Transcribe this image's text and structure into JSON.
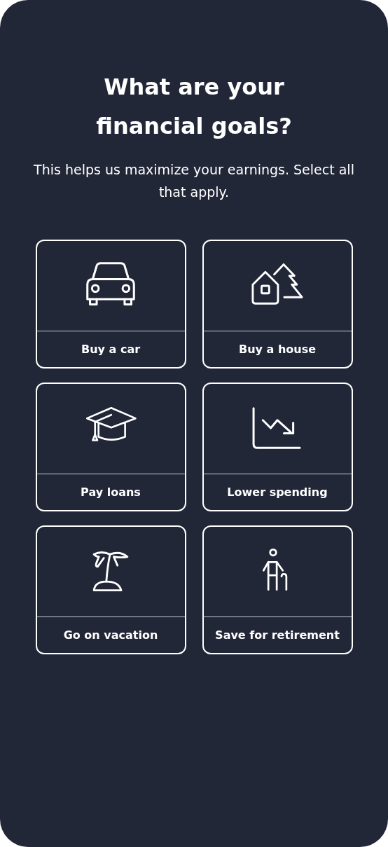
{
  "title": "What are your financial goals?",
  "subtitle": "This helps us maximize your earnings. Select all that apply.",
  "goals": [
    {
      "kind": "car",
      "label": "Buy a car",
      "selected": false
    },
    {
      "kind": "house",
      "label": "Buy a house",
      "selected": false
    },
    {
      "kind": "graduation",
      "label": "Pay loans",
      "selected": false
    },
    {
      "kind": "chart",
      "label": "Lower spending",
      "selected": false
    },
    {
      "kind": "palm",
      "label": "Go on vacation",
      "selected": false
    },
    {
      "kind": "elder",
      "label": "Save for retirement",
      "selected": false
    }
  ]
}
